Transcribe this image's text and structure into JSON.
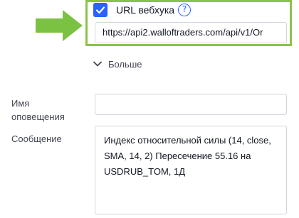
{
  "webhook": {
    "checked": true,
    "label": "URL вебхука",
    "help_icon": "question-circle-icon",
    "url_value": "https://api2.walloftraders.com/api/v1/Or"
  },
  "more": {
    "label": "Больше",
    "icon": "chevron-down-icon"
  },
  "alert_name": {
    "label": "Имя оповещения",
    "value": ""
  },
  "message": {
    "label": "Сообщение",
    "value": "Индекс относительной силы (14, close, SMA, 14, 2) Пересечение 55.16 на USDRUB_TOM, 1Д"
  },
  "colors": {
    "accent": "#2962ff",
    "highlight": "#8bc34a",
    "arrow": "#7cc242"
  }
}
